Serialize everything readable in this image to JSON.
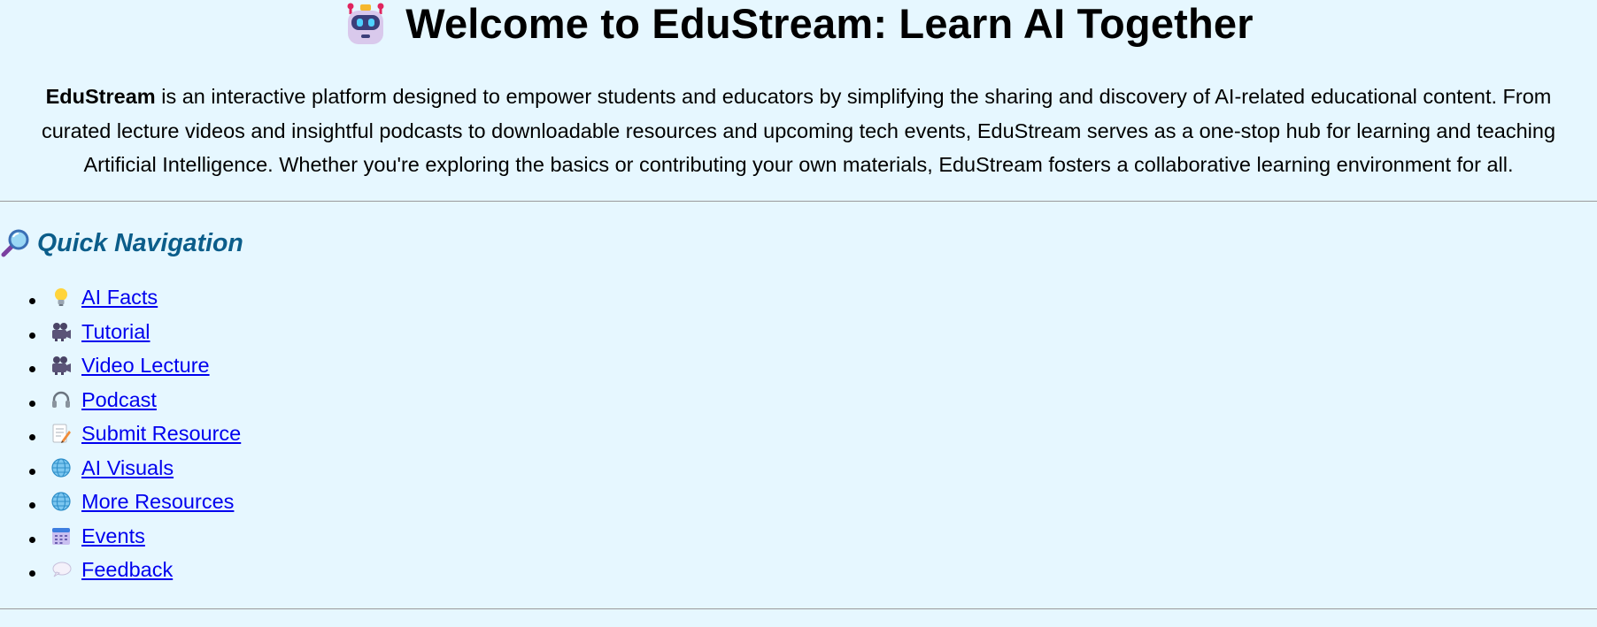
{
  "header": {
    "title": "Welcome to EduStream: Learn AI Together",
    "icon": "robot-icon"
  },
  "intro": {
    "brand": "EduStream",
    "text": " is an interactive platform designed to empower students and educators by simplifying the sharing and discovery of AI-related educational content. From curated lecture videos and insightful podcasts to downloadable resources and upcoming tech events, EduStream serves as a one-stop hub for learning and teaching Artificial Intelligence. Whether you're exploring the basics or contributing your own materials, EduStream fosters a collaborative learning environment for all."
  },
  "navigation": {
    "heading": "Quick Navigation",
    "heading_icon": "magnifier-icon",
    "items": [
      {
        "label": "AI Facts",
        "icon": "lightbulb-icon"
      },
      {
        "label": "Tutorial",
        "icon": "movie-camera-icon"
      },
      {
        "label": "Video Lecture",
        "icon": "movie-camera-icon"
      },
      {
        "label": "Podcast",
        "icon": "headphones-icon"
      },
      {
        "label": "Submit Resource",
        "icon": "memo-icon"
      },
      {
        "label": "AI Visuals",
        "icon": "globe-icon"
      },
      {
        "label": "More Resources",
        "icon": "globe-icon"
      },
      {
        "label": "Events",
        "icon": "calendar-icon"
      },
      {
        "label": "Feedback",
        "icon": "speech-balloon-icon"
      }
    ]
  },
  "colors": {
    "background": "#e6f7ff",
    "heading_accent": "#0b5d8a",
    "link": "#0000ee"
  }
}
